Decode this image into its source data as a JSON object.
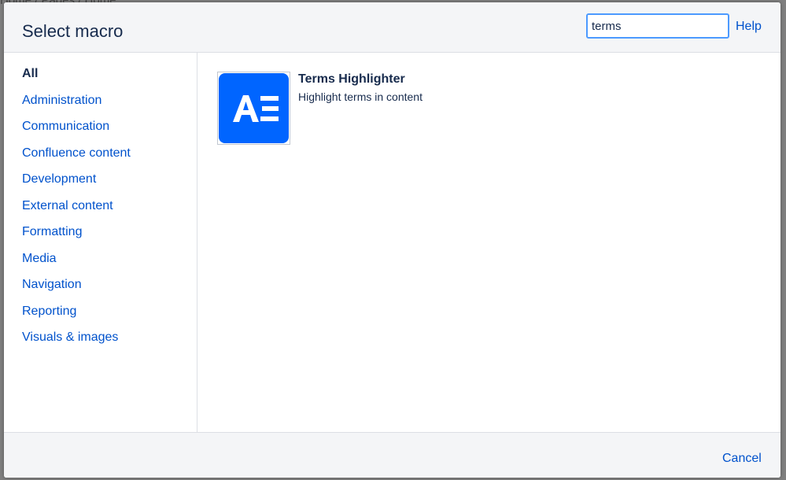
{
  "background": {
    "breadcrumb": "Home  /  Pages  /  Home"
  },
  "dialog": {
    "title": "Select macro",
    "search": {
      "value": "terms",
      "placeholder": ""
    },
    "help_label": "Help",
    "cancel_label": "Cancel"
  },
  "sidebar": {
    "items": [
      {
        "label": "All",
        "active": true
      },
      {
        "label": "Administration"
      },
      {
        "label": "Communication"
      },
      {
        "label": "Confluence content"
      },
      {
        "label": "Development"
      },
      {
        "label": "External content"
      },
      {
        "label": "Formatting"
      },
      {
        "label": "Media"
      },
      {
        "label": "Navigation"
      },
      {
        "label": "Reporting"
      },
      {
        "label": "Visuals & images"
      }
    ]
  },
  "results": [
    {
      "name": "Terms Highlighter",
      "description": "Highlight terms in content",
      "icon": "terms-highlighter-logo-icon"
    }
  ],
  "colors": {
    "link": "#0052cc",
    "text": "#172b4d",
    "accent_focus": "#4c9aff",
    "icon_bg": "#0065ff"
  }
}
